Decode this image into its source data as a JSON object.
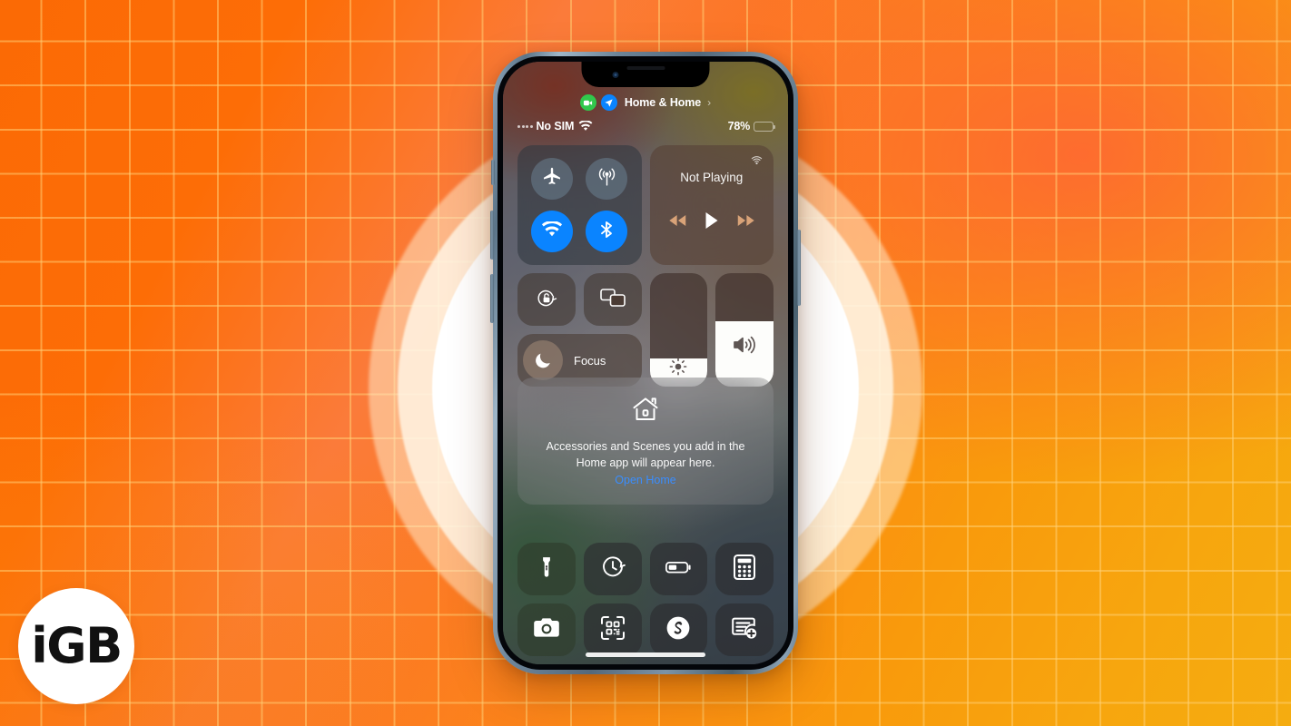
{
  "background": {
    "style": "orange-gradient-grid",
    "color_top_left": "#fa7208",
    "color_top_right": "#fb5c3c",
    "color_bottom_right": "#f5ac10",
    "grid_line_color": "#ffd278"
  },
  "logo": {
    "text": "iGB",
    "name": "igb-logo"
  },
  "phone": {
    "notch": {
      "camera": "front-camera",
      "speaker": "earpiece-speaker"
    },
    "buttons": [
      "silent-switch",
      "volume-up",
      "volume-down",
      "power"
    ]
  },
  "header": {
    "recording_icon": "screen-record-icon",
    "location_icon": "location-arrow-icon",
    "title": "Home & Home",
    "chevron": "›"
  },
  "statusbar": {
    "signal_dots": 4,
    "carrier": "No SIM",
    "wifi_icon": "wifi-icon",
    "battery_percent": "78%",
    "battery_level": 78
  },
  "connectivity": {
    "airplane": {
      "label": "Airplane Mode",
      "icon": "airplane-icon",
      "on": false
    },
    "cellular": {
      "label": "Cellular Data",
      "icon": "cellular-icon",
      "on": false
    },
    "wifi": {
      "label": "Wi-Fi",
      "icon": "wifi-icon",
      "on": true
    },
    "bluetooth": {
      "label": "Bluetooth",
      "icon": "bluetooth-icon",
      "on": true
    },
    "color_on": "#0a84ff",
    "color_off": "rgba(120,146,168,0.42)"
  },
  "media": {
    "airplay_icon": "airplay-audio-icon",
    "title": "Not Playing",
    "rewind_icon": "rewind-icon",
    "play_icon": "play-icon",
    "forward_icon": "fast-forward-icon"
  },
  "controls": {
    "rotation_lock": {
      "label": "Rotation Lock",
      "icon": "rotation-lock-icon"
    },
    "screen_mirroring": {
      "label": "Screen Mirroring",
      "icon": "screen-mirroring-icon"
    },
    "focus": {
      "label": "Focus",
      "icon": "moon-icon"
    }
  },
  "sliders": {
    "brightness": {
      "label": "Brightness",
      "icon": "brightness-icon",
      "value": 25
    },
    "volume": {
      "label": "Volume",
      "icon": "speaker-wave-icon",
      "value": 58
    }
  },
  "home": {
    "icon": "house-icon",
    "description": "Accessories and Scenes you add in the Home app will appear here.",
    "link": "Open Home"
  },
  "shortcuts": [
    {
      "name": "flashlight",
      "icon": "flashlight-icon",
      "tint": "green"
    },
    {
      "name": "timer",
      "icon": "timer-icon",
      "tint": "dark"
    },
    {
      "name": "low-power-mode",
      "icon": "battery-icon",
      "tint": "dark"
    },
    {
      "name": "calculator",
      "icon": "calculator-icon",
      "tint": "dark"
    },
    {
      "name": "camera",
      "icon": "camera-icon",
      "tint": "green"
    },
    {
      "name": "code-scanner",
      "icon": "qr-scanner-icon",
      "tint": "dark"
    },
    {
      "name": "shazam",
      "icon": "shazam-icon",
      "tint": "dark"
    },
    {
      "name": "notes",
      "icon": "notes-add-icon",
      "tint": "dark"
    }
  ]
}
